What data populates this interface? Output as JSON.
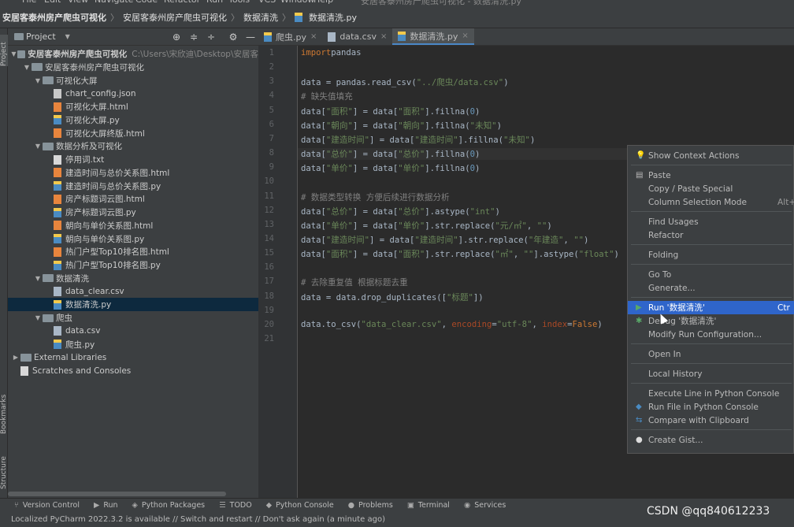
{
  "menubar": {
    "items": [
      "File",
      "Edit",
      "View",
      "Navigate",
      "Code",
      "Refactor",
      "Run",
      "Tools",
      "VCS",
      "Window",
      "Help"
    ],
    "window_title": "安居客泰州房产爬虫可视化 - 数据清洗.py"
  },
  "breadcrumb": {
    "project": "安居客泰州房产爬虫可视化",
    "folder": "安居客泰州房产爬虫可视化",
    "subfolder": "数据清洗",
    "file": "数据清洗.py"
  },
  "side_labels": {
    "project": "Project",
    "bookmarks": "Bookmarks",
    "structure": "Structure"
  },
  "project_panel": {
    "title": "Project",
    "tree": [
      {
        "depth": 0,
        "type": "folder",
        "open": true,
        "label": "安居客泰州房产爬虫可视化",
        "extra": "C:\\Users\\宋欣迪\\Desktop\\安居客"
      },
      {
        "depth": 1,
        "type": "folder",
        "open": true,
        "label": "安居客泰州房产爬虫可视化"
      },
      {
        "depth": 2,
        "type": "folder",
        "open": true,
        "label": "可视化大屏"
      },
      {
        "depth": 3,
        "type": "json",
        "label": "chart_config.json"
      },
      {
        "depth": 3,
        "type": "html",
        "label": "可视化大屏.html"
      },
      {
        "depth": 3,
        "type": "py",
        "label": "可视化大屏.py"
      },
      {
        "depth": 3,
        "type": "html",
        "label": "可视化大屏终版.html"
      },
      {
        "depth": 2,
        "type": "folder",
        "open": true,
        "label": "数据分析及可视化"
      },
      {
        "depth": 3,
        "type": "txt",
        "label": "停用词.txt"
      },
      {
        "depth": 3,
        "type": "html",
        "label": "建造时间与总价关系图.html"
      },
      {
        "depth": 3,
        "type": "py",
        "label": "建造时间与总价关系图.py"
      },
      {
        "depth": 3,
        "type": "html",
        "label": "房产标题词云图.html"
      },
      {
        "depth": 3,
        "type": "py",
        "label": "房产标题词云图.py"
      },
      {
        "depth": 3,
        "type": "html",
        "label": "朝向与单价关系图.html"
      },
      {
        "depth": 3,
        "type": "py",
        "label": "朝向与单价关系图.py"
      },
      {
        "depth": 3,
        "type": "html",
        "label": "热门户型Top10排名图.html"
      },
      {
        "depth": 3,
        "type": "py",
        "label": "热门户型Top10排名图.py"
      },
      {
        "depth": 2,
        "type": "folder",
        "open": true,
        "label": "数据清洗"
      },
      {
        "depth": 3,
        "type": "csv",
        "label": "data_clear.csv"
      },
      {
        "depth": 3,
        "type": "py",
        "label": "数据清洗.py",
        "selected": true
      },
      {
        "depth": 2,
        "type": "folder",
        "open": true,
        "label": "爬虫"
      },
      {
        "depth": 3,
        "type": "csv",
        "label": "data.csv"
      },
      {
        "depth": 3,
        "type": "py",
        "label": "爬虫.py"
      },
      {
        "depth": 0,
        "type": "lib",
        "open": false,
        "label": "External Libraries"
      },
      {
        "depth": 0,
        "type": "scratch",
        "label": "Scratches and Consoles"
      }
    ]
  },
  "editor_tabs": [
    {
      "label": "爬虫.py",
      "type": "py"
    },
    {
      "label": "data.csv",
      "type": "csv"
    },
    {
      "label": "数据清洗.py",
      "type": "py",
      "active": true
    }
  ],
  "code_lines": [
    [
      [
        "kw",
        "import"
      ],
      [
        "",
        "pandas"
      ]
    ],
    [],
    [
      [
        "",
        "data = pandas.read_csv("
      ],
      [
        "str",
        "\"../爬虫/data.csv\""
      ],
      [
        "",
        ")"
      ]
    ],
    [
      [
        "cm",
        "# 缺失值填充"
      ]
    ],
    [
      [
        "",
        "data["
      ],
      [
        "str",
        "\"面积\""
      ],
      [
        "",
        "] = data["
      ],
      [
        "str",
        "\"面积\""
      ],
      [
        "",
        "].fillna("
      ],
      [
        "num",
        "0"
      ],
      [
        "",
        ")"
      ]
    ],
    [
      [
        "",
        "data["
      ],
      [
        "str",
        "\"朝向\""
      ],
      [
        "",
        "] = data["
      ],
      [
        "str",
        "\"朝向\""
      ],
      [
        "",
        "].fillna("
      ],
      [
        "str",
        "\"未知\""
      ],
      [
        "",
        ")"
      ]
    ],
    [
      [
        "",
        "data["
      ],
      [
        "str",
        "\"建造时间\""
      ],
      [
        "",
        "] = data["
      ],
      [
        "str",
        "\"建造时间\""
      ],
      [
        "",
        "].fillna("
      ],
      [
        "str",
        "\"未知\""
      ],
      [
        "",
        ")"
      ]
    ],
    [
      [
        "",
        "data["
      ],
      [
        "str",
        "\"总价\""
      ],
      [
        "",
        "] = data["
      ],
      [
        "str",
        "\"总价\""
      ],
      [
        "",
        "].fillna("
      ],
      [
        "num",
        "0"
      ],
      [
        "",
        ")"
      ]
    ],
    [
      [
        "",
        "data["
      ],
      [
        "str",
        "\"单价\""
      ],
      [
        "",
        "] = data["
      ],
      [
        "str",
        "\"单价\""
      ],
      [
        "",
        "].fillna("
      ],
      [
        "num",
        "0"
      ],
      [
        "",
        ")"
      ]
    ],
    [],
    [
      [
        "cm",
        "# 数据类型转换 方便后续进行数据分析"
      ]
    ],
    [
      [
        "",
        "data["
      ],
      [
        "str",
        "\"总价\""
      ],
      [
        "",
        "] = data["
      ],
      [
        "str",
        "\"总价\""
      ],
      [
        "",
        "].astype("
      ],
      [
        "str",
        "\"int\""
      ],
      [
        "",
        ")"
      ]
    ],
    [
      [
        "",
        "data["
      ],
      [
        "str",
        "\"单价\""
      ],
      [
        "",
        "] = data["
      ],
      [
        "str",
        "\"单价\""
      ],
      [
        "",
        "].str.replace("
      ],
      [
        "str",
        "\"元/㎡\""
      ],
      [
        "",
        ", "
      ],
      [
        "str",
        "\"\""
      ],
      [
        "",
        ")"
      ]
    ],
    [
      [
        "",
        "data["
      ],
      [
        "str",
        "\"建造时间\""
      ],
      [
        "",
        "] = data["
      ],
      [
        "str",
        "\"建造时间\""
      ],
      [
        "",
        "].str.replace("
      ],
      [
        "str",
        "\"年建造\""
      ],
      [
        "",
        ", "
      ],
      [
        "str",
        "\"\""
      ],
      [
        "",
        ")"
      ]
    ],
    [
      [
        "",
        "data["
      ],
      [
        "str",
        "\"面积\""
      ],
      [
        "",
        "] = data["
      ],
      [
        "str",
        "\"面积\""
      ],
      [
        "",
        "].str.replace("
      ],
      [
        "str",
        "\"㎡\""
      ],
      [
        "",
        ", "
      ],
      [
        "str",
        "\"\""
      ],
      [
        "",
        "].astype("
      ],
      [
        "str",
        "\"float\""
      ],
      [
        "",
        ")"
      ]
    ],
    [],
    [
      [
        "cm",
        "# 去除重复值 根据标题去重"
      ]
    ],
    [
      [
        "",
        "data = data.drop_duplicates(["
      ],
      [
        "str",
        "\"标题\""
      ],
      [
        "",
        "])"
      ]
    ],
    [],
    [
      [
        "",
        "data.to_csv("
      ],
      [
        "str",
        "\"data_clear.csv\""
      ],
      [
        "",
        ", "
      ],
      [
        "param",
        "encoding"
      ],
      [
        "",
        "="
      ],
      [
        "str",
        "\"utf-8\""
      ],
      [
        "",
        ", "
      ],
      [
        "param",
        "index"
      ],
      [
        "",
        "="
      ],
      [
        "kw",
        "False"
      ],
      [
        "",
        ")"
      ]
    ],
    []
  ],
  "context_menu": [
    {
      "label": "Show Context Actions",
      "icon": "bulb-icon"
    },
    {
      "sep": true
    },
    {
      "label": "Paste",
      "icon": "paste-icon"
    },
    {
      "label": "Copy / Paste Special"
    },
    {
      "label": "Column Selection Mode",
      "shortcut": "Alt+"
    },
    {
      "sep": true
    },
    {
      "label": "Find Usages"
    },
    {
      "label": "Refactor"
    },
    {
      "sep": true
    },
    {
      "label": "Folding"
    },
    {
      "sep": true
    },
    {
      "label": "Go To"
    },
    {
      "label": "Generate..."
    },
    {
      "sep": true
    },
    {
      "label": "Run '数据清洗'",
      "icon": "run-icon",
      "shortcut": "Ctr",
      "active": true
    },
    {
      "label": "Debug '数据清洗'",
      "icon": "debug-icon"
    },
    {
      "label": "Modify Run Configuration..."
    },
    {
      "sep": true
    },
    {
      "label": "Open In"
    },
    {
      "sep": true
    },
    {
      "label": "Local History"
    },
    {
      "sep": true
    },
    {
      "label": "Execute Line in Python Console"
    },
    {
      "label": "Run File in Python Console",
      "icon": "python-icon"
    },
    {
      "label": "Compare with Clipboard",
      "icon": "compare-icon"
    },
    {
      "sep": true
    },
    {
      "label": "Create Gist...",
      "icon": "github-icon"
    }
  ],
  "tool_tabs": [
    {
      "label": "Version Control",
      "icon": "vcs-icon"
    },
    {
      "label": "Run",
      "icon": "run-icon"
    },
    {
      "label": "Python Packages",
      "icon": "packages-icon"
    },
    {
      "label": "TODO",
      "icon": "todo-icon"
    },
    {
      "label": "Python Console",
      "icon": "python-icon"
    },
    {
      "label": "Problems",
      "icon": "problems-icon"
    },
    {
      "label": "Terminal",
      "icon": "terminal-icon"
    },
    {
      "label": "Services",
      "icon": "services-icon"
    }
  ],
  "status": "Localized PyCharm 2022.3.2 is available // Switch and restart // Don't ask again (a minute ago)",
  "watermark": "CSDN @qq840612233",
  "colors": {
    "accent": "#2f65ca",
    "keyword": "#cc7832",
    "string": "#6a8759",
    "number": "#6897bb",
    "comment": "#808080"
  }
}
